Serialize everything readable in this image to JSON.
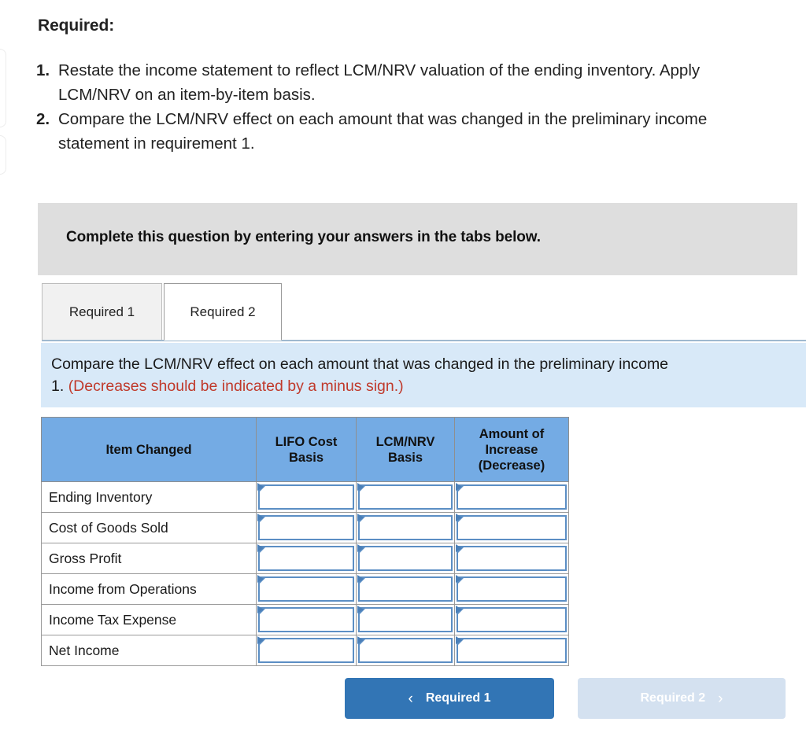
{
  "required": {
    "heading": "Required:",
    "items": [
      {
        "num": "1.",
        "text": "Restate the income statement to reflect LCM/NRV valuation of the ending inventory. Apply LCM/NRV on an item-by-item basis."
      },
      {
        "num": "2.",
        "text": "Compare the LCM/NRV effect on each amount that was changed in the preliminary income statement in requirement 1."
      }
    ]
  },
  "banner": {
    "text": "Complete this question by entering your answers in the tabs below."
  },
  "tabs": [
    {
      "label": "Required 1",
      "active": false
    },
    {
      "label": "Required 2",
      "active": true
    }
  ],
  "info_box": {
    "line1": "Compare the LCM/NRV effect on each amount that was changed in the preliminary income",
    "line2_prefix": "1.",
    "line2_hint": "(Decreases should be indicated by a minus sign.)"
  },
  "table": {
    "headers": [
      "Item Changed",
      "LIFO Cost Basis",
      "LCM/NRV Basis",
      "Amount of Increase (Decrease)"
    ],
    "headers_wrapped": [
      [
        "Item Changed"
      ],
      [
        "LIFO Cost",
        "Basis"
      ],
      [
        "LCM/NRV",
        "Basis"
      ],
      [
        "Amount of",
        "Increase",
        "(Decrease)"
      ]
    ],
    "rows": [
      {
        "label": "Ending Inventory",
        "lifo_cost_basis": "",
        "lcm_nrv_basis": "",
        "increase_decrease": ""
      },
      {
        "label": "Cost of Goods Sold",
        "lifo_cost_basis": "",
        "lcm_nrv_basis": "",
        "increase_decrease": ""
      },
      {
        "label": "Gross Profit",
        "lifo_cost_basis": "",
        "lcm_nrv_basis": "",
        "increase_decrease": ""
      },
      {
        "label": "Income from Operations",
        "lifo_cost_basis": "",
        "lcm_nrv_basis": "",
        "increase_decrease": ""
      },
      {
        "label": "Income Tax Expense",
        "lifo_cost_basis": "",
        "lcm_nrv_basis": "",
        "increase_decrease": ""
      },
      {
        "label": "Net Income",
        "lifo_cost_basis": "",
        "lcm_nrv_basis": "",
        "increase_decrease": ""
      }
    ]
  },
  "footer": {
    "prev_label": "Required 1",
    "prev_icon": "chevron-left-icon",
    "next_label": "Required 2",
    "next_icon": "chevron-right-icon"
  },
  "colors": {
    "header_blue": "#74abe4",
    "info_blue": "#d8e9f8",
    "banner_gray": "#dedede",
    "button_blue": "#3275b5",
    "button_disabled": "#d4e1f0",
    "hint_red": "#c0392b",
    "input_border": "#5b8ec4"
  }
}
